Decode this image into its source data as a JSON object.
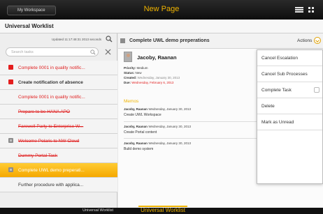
{
  "topbar": {
    "workspace_label": "My Workspace",
    "title": "New Page"
  },
  "worklist": {
    "title": "Universal Worklist"
  },
  "left": {
    "updated_text": "Updated 11:17:48:31 2013 seconds",
    "search_placeholder": "Search tasks",
    "items": [
      {
        "label": "Complete 0001 in quality notific...",
        "style": "red",
        "icon": "red"
      },
      {
        "label": "Create notification of absence",
        "style": "dark-bold",
        "icon": "red"
      },
      {
        "label": "Complete 0001 in quality notific...",
        "style": "red",
        "icon": "none"
      },
      {
        "label": "Prepare to be HANA APO",
        "style": "red-strike",
        "icon": "none"
      },
      {
        "label": "Farewell Party to Enterprise W...",
        "style": "red-strike",
        "icon": "none"
      },
      {
        "label": "Welcome Polaris to NW Cloud",
        "style": "red-strike",
        "icon": "gray"
      },
      {
        "label": "Dummy Portal Task",
        "style": "red-strike",
        "icon": "none"
      },
      {
        "label": "Complete UWL demo preperati...",
        "style": "selected",
        "icon": "gray"
      },
      {
        "label": "Further procedure with applica...",
        "style": "dark",
        "icon": "none"
      }
    ]
  },
  "detail": {
    "title": "Complete UWL demo preperations",
    "actions_label": "Actions",
    "person": "Jacoby, Raanan",
    "priority_label": "Priority:",
    "priority_value": "Medium",
    "status_label": "Status:",
    "status_value": "New",
    "created_label": "Created:",
    "created_value": "Wednesday, January 30, 2013",
    "due_label": "Due:",
    "due_value": "Wednesday, February 6, 2013",
    "memos_title": "Memos",
    "memos": [
      {
        "who": "Jacoby, Raanan",
        "when": "Wednesday, January 30, 2013",
        "body": "Create UWL Workspace"
      },
      {
        "who": "Jacoby, Raanan",
        "when": "Wednesday, January 30, 2013",
        "body": "Create Portal content"
      },
      {
        "who": "Jacoby, Raanan",
        "when": "Wednesday, January 30, 2013",
        "body": "Build demo system"
      }
    ]
  },
  "actions_menu": {
    "items": [
      "Cancel Escalation",
      "Cancel Sub Processes",
      "Complete Task",
      "Delete",
      "Mark as Unread"
    ]
  },
  "bottombar": {
    "left_label": "Universal Worklist",
    "active_tab": "Universal Worklist"
  },
  "colors": {
    "accent": "#f0b400",
    "overdue": "#e02020",
    "selected_bg": "#ffc21a"
  }
}
